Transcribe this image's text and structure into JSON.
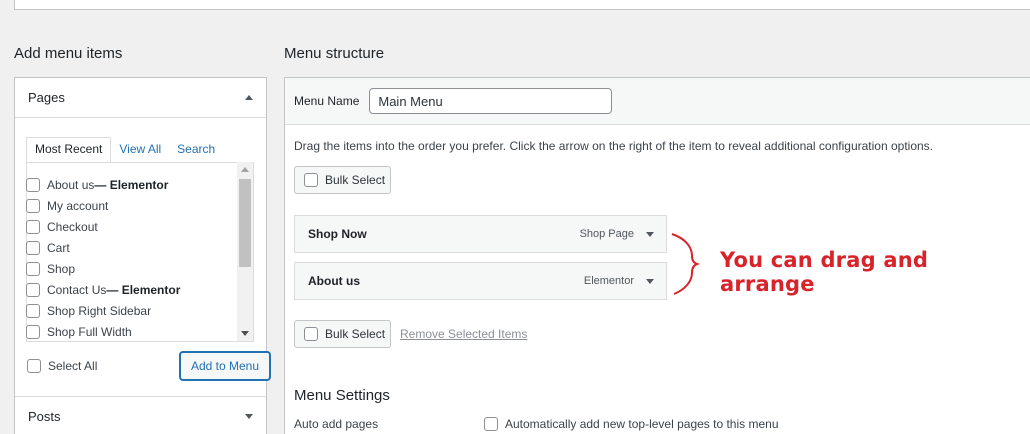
{
  "left": {
    "title": "Add menu items",
    "pages": {
      "heading": "Pages",
      "tabs": [
        "Most Recent",
        "View All",
        "Search"
      ],
      "items": [
        {
          "text": "About us",
          "suffix": " — Elementor"
        },
        {
          "text": "My account",
          "suffix": ""
        },
        {
          "text": "Checkout",
          "suffix": ""
        },
        {
          "text": "Cart",
          "suffix": ""
        },
        {
          "text": "Shop",
          "suffix": ""
        },
        {
          "text": "Contact Us",
          "suffix": " — Elementor"
        },
        {
          "text": "Shop Right Sidebar",
          "suffix": ""
        },
        {
          "text": "Shop Full Width",
          "suffix": ""
        }
      ],
      "select_all": "Select All",
      "add_button": "Add to Menu"
    },
    "posts_heading": "Posts"
  },
  "right": {
    "title": "Menu structure",
    "menu_name_label": "Menu Name",
    "menu_name_value": "Main Menu",
    "instructions": "Drag the items into the order you prefer. Click the arrow on the right of the item to reveal additional configuration options.",
    "bulk_select": "Bulk Select",
    "remove_selected": "Remove Selected Items",
    "menu_items": [
      {
        "title": "Shop Now",
        "type": "Shop Page"
      },
      {
        "title": "About us",
        "type": "Elementor"
      }
    ],
    "settings": {
      "title": "Menu Settings",
      "auto_add_label": "Auto add pages",
      "auto_add_checkbox": "Automatically add new top-level pages to this menu"
    }
  },
  "annotation": {
    "text": "You can drag and arrange",
    "color": "#d8232a"
  },
  "colors": {
    "link": "#2271b1",
    "background": "#f0f0f1"
  }
}
